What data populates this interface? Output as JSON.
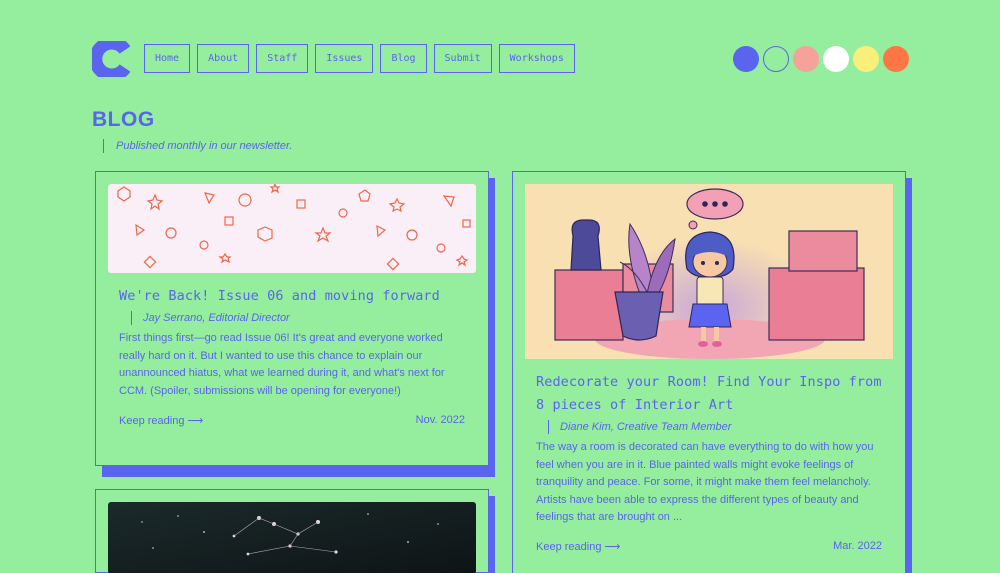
{
  "header": {
    "logo_icon": "c-logo-icon",
    "nav": [
      "Home",
      "About",
      "Staff",
      "Issues",
      "Blog",
      "Submit",
      "Workshops"
    ],
    "theme_swatches": [
      "#5a64ee",
      "#94ee9d",
      "#f5a29a",
      "#ffffff",
      "#f8f07a",
      "#ff7646"
    ]
  },
  "page": {
    "title": "BLOG",
    "subtitle": "Published monthly in our newsletter."
  },
  "posts": [
    {
      "title": "We're Back! Issue 06 and moving forward",
      "byline": "Jay Serrano, Editorial Director",
      "excerpt": "First things first—go read Issue 06! It's great and everyone worked really hard on it. But I wanted to use this chance to explain our unannounced hiatus, what we learned during it, and what's next for CCM. (Spoiler, submissions will be opening for everyone!)",
      "read_more": "Keep reading ⟶",
      "date": "Nov. 2022",
      "image": "geometric-shapes-banner"
    },
    {
      "title": "Redecorate your Room! Find Your Inspo from 8 pieces of Interior Art",
      "byline": "Diane Kim, Creative Team Member",
      "excerpt": "The way a room is decorated can have everything to do with how you feel when you are in it. Blue painted walls might evoke feelings of tranquility and peace. For some, it might make them feel melancholy. Artists have been able to express the different types of beauty and feelings that are brought on ...",
      "read_more": "Keep reading ⟶",
      "date": "Mar. 2022",
      "image": "girl-in-room-illustration"
    },
    {
      "image": "night-sky-constellation"
    }
  ]
}
